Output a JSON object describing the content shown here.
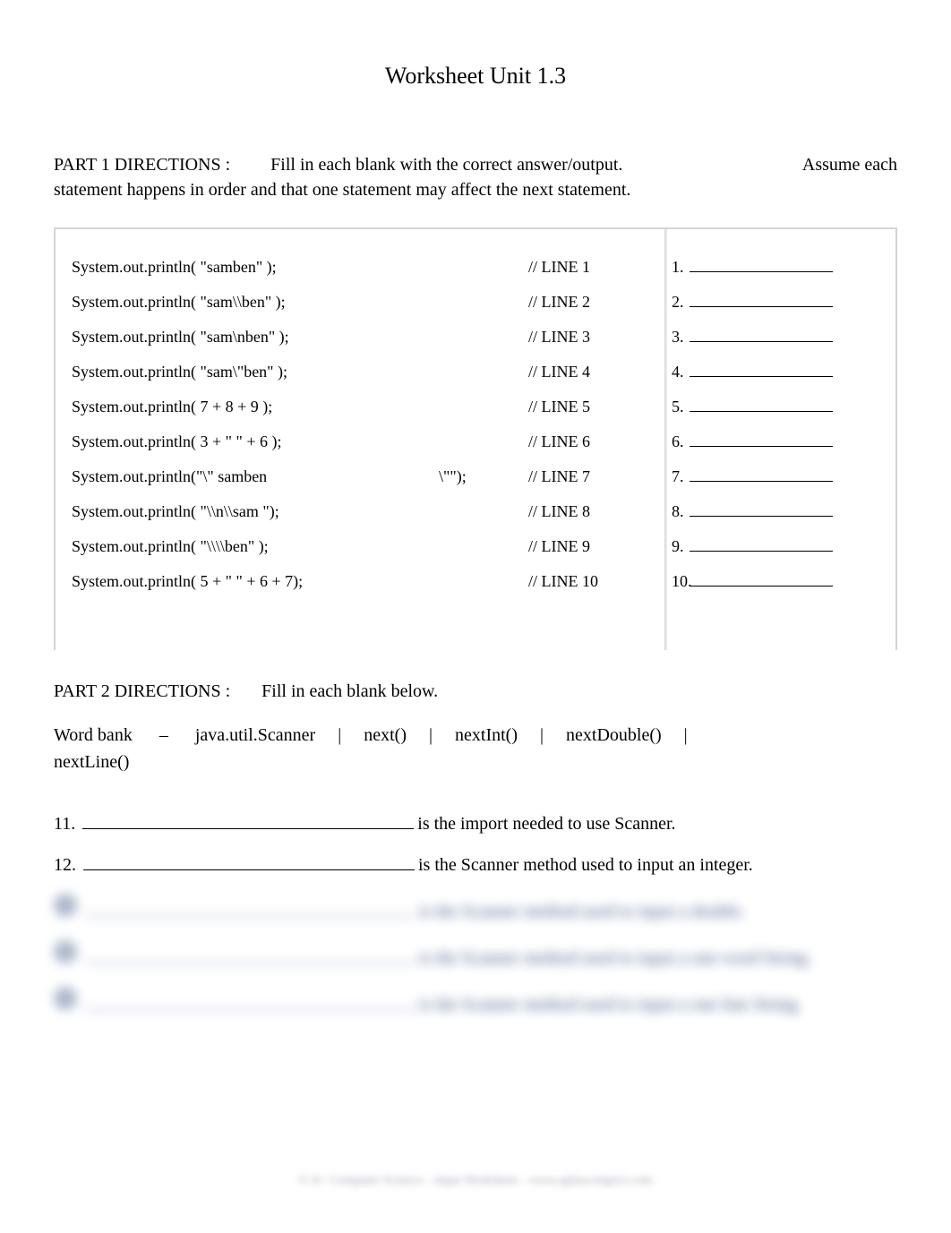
{
  "title": "Worksheet Unit 1.3",
  "part1": {
    "label": "PART 1 DIRECTIONS :",
    "text1": "Fill in each blank with the correct answer/output.",
    "assume": "Assume each",
    "text2": "statement happens in order and that one statement may affect the next statement."
  },
  "code": [
    {
      "stmt": "System.out.println( \"samben\" );",
      "extra": "",
      "line": "// LINE 1",
      "num": "1."
    },
    {
      "stmt": "System.out.println( \"sam\\\\ben\" );",
      "extra": "",
      "line": "// LINE 2",
      "num": "2."
    },
    {
      "stmt": "System.out.println( \"sam\\nben\" );",
      "extra": "",
      "line": "// LINE 3",
      "num": "3."
    },
    {
      "stmt": "System.out.println( \"sam\\\"ben\" );",
      "extra": "",
      "line": "// LINE 4",
      "num": "4."
    },
    {
      "stmt": "System.out.println( 7 + 8 + 9 );",
      "extra": "",
      "line": "// LINE 5",
      "num": "5."
    },
    {
      "stmt": "System.out.println( 3 + \" \" + 6 );",
      "extra": "",
      "line": "// LINE 6",
      "num": "6."
    },
    {
      "stmt": "System.out.println(\"\\\" samben",
      "extra": "\\\"\");",
      "line": "// LINE 7",
      "num": "7."
    },
    {
      "stmt": "System.out.println( \"\\\\n\\\\sam \");",
      "extra": "",
      "line": "// LINE 8",
      "num": "8."
    },
    {
      "stmt": "System.out.println( \"\\\\\\\\ben\" );",
      "extra": "",
      "line": "// LINE 9",
      "num": "9."
    },
    {
      "stmt": "System.out.println( 5 + \" \" + 6 + 7);",
      "extra": "",
      "line": "// LINE 10",
      "num": "10."
    }
  ],
  "part2": {
    "label": "PART 2 DIRECTIONS :",
    "text": "Fill in each blank below."
  },
  "wordbank": {
    "label": "Word bank",
    "dash": "–",
    "items": [
      "java.util.Scanner",
      "next()",
      "nextInt()",
      "nextDouble()",
      "nextLine()"
    ]
  },
  "questions": [
    {
      "num": "11.",
      "text": "is the import needed to use Scanner.",
      "blurred": false
    },
    {
      "num": "12.",
      "text": "is the Scanner method used to input an integer.",
      "blurred": false
    },
    {
      "num": "13.",
      "text": "is the Scanner method used to input a double.",
      "blurred": true
    },
    {
      "num": "14.",
      "text": "is the Scanner method used to input a one word String.",
      "blurred": true
    },
    {
      "num": "15.",
      "text": "is the Scanner method used to input a one line String.",
      "blurred": true
    }
  ],
  "footer": "© A+ Computer Science – Input Worksheet – www.apluscompsci.com"
}
